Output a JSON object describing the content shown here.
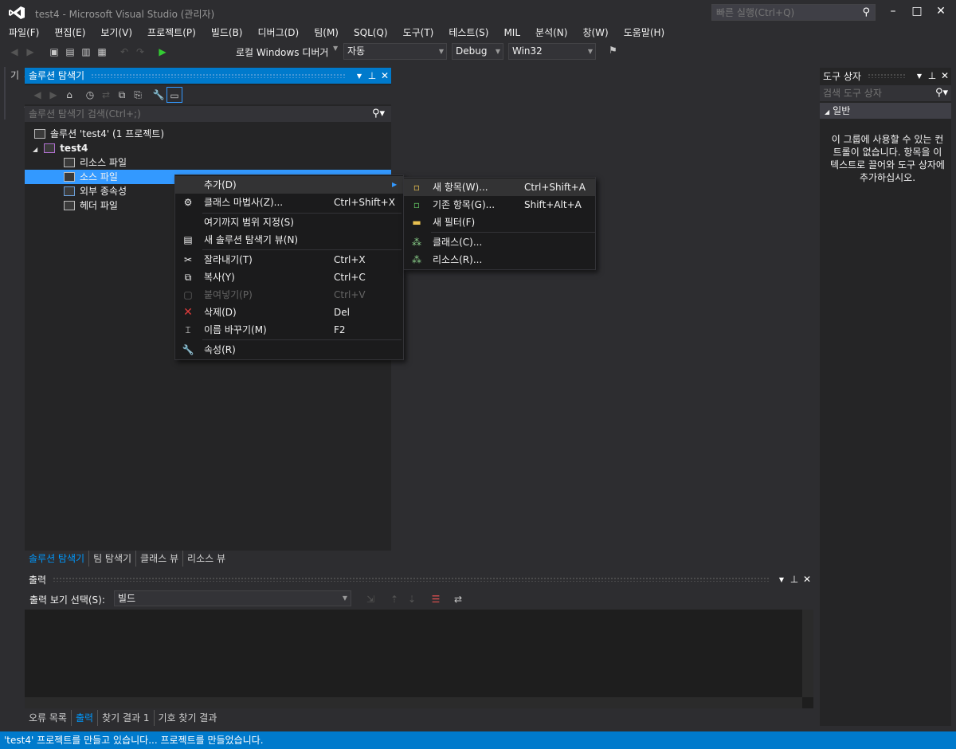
{
  "window": {
    "title": "test4 - Microsoft Visual Studio (관리자)"
  },
  "quick_launch": {
    "placeholder": "빠른 실행(Ctrl+Q)"
  },
  "menubar": [
    "파일(F)",
    "편집(E)",
    "보기(V)",
    "프로젝트(P)",
    "빌드(B)",
    "디버그(D)",
    "팀(M)",
    "SQL(Q)",
    "도구(T)",
    "테스트(S)",
    "MIL",
    "분석(N)",
    "창(W)",
    "도움말(H)"
  ],
  "toolbar": {
    "debugger": "로컬 Windows 디버거",
    "mode": "자동",
    "config": "Debug",
    "platform": "Win32"
  },
  "left_vertical_tab": "서버 탐색기",
  "solution_explorer": {
    "title": "솔루션 탐색기",
    "search_placeholder": "솔루션 탐색기 검색(Ctrl+;)",
    "tree": {
      "solution": "솔루션 'test4' (1 프로젝트)",
      "project": "test4",
      "folders": [
        "리소스 파일",
        "소스 파일",
        "외부 종속성",
        "헤더 파일"
      ]
    },
    "tabs": [
      "솔루션 탐색기",
      "팀 탐색기",
      "클래스 뷰",
      "리소스 뷰"
    ]
  },
  "context_menu": {
    "add": "추가(D)",
    "class_wizard": {
      "label": "클래스 마법사(Z)...",
      "shortcut": "Ctrl+Shift+X"
    },
    "scope_to_this": "여기까지 범위 지정(S)",
    "new_se_view": "새 솔루션 탐색기 뷰(N)",
    "cut": {
      "label": "잘라내기(T)",
      "shortcut": "Ctrl+X"
    },
    "copy": {
      "label": "복사(Y)",
      "shortcut": "Ctrl+C"
    },
    "paste": {
      "label": "붙여넣기(P)",
      "shortcut": "Ctrl+V"
    },
    "delete": {
      "label": "삭제(D)",
      "shortcut": "Del"
    },
    "rename": {
      "label": "이름 바꾸기(M)",
      "shortcut": "F2"
    },
    "properties": "속성(R)"
  },
  "submenu": {
    "new_item": {
      "label": "새 항목(W)...",
      "shortcut": "Ctrl+Shift+A"
    },
    "existing_item": {
      "label": "기존 항목(G)...",
      "shortcut": "Shift+Alt+A"
    },
    "new_filter": "새 필터(F)",
    "class": "클래스(C)...",
    "resource": "리소스(R)..."
  },
  "toolbox": {
    "title": "도구 상자",
    "search_placeholder": "검색 도구 상자",
    "category": "일반",
    "empty_message": "이 그룹에 사용할 수 있는 컨트롤이 없습니다. 항목을 이 텍스트로 끌어와 도구 상자에 추가하십시오."
  },
  "output": {
    "title": "출력",
    "source_label": "출력 보기 선택(S):",
    "source_value": "빌드",
    "tabs": [
      "오류 목록",
      "출력",
      "찾기 결과 1",
      "기호 찾기 결과"
    ]
  },
  "status": "'test4' 프로젝트를 만들고 있습니다... 프로젝트를 만들었습니다."
}
